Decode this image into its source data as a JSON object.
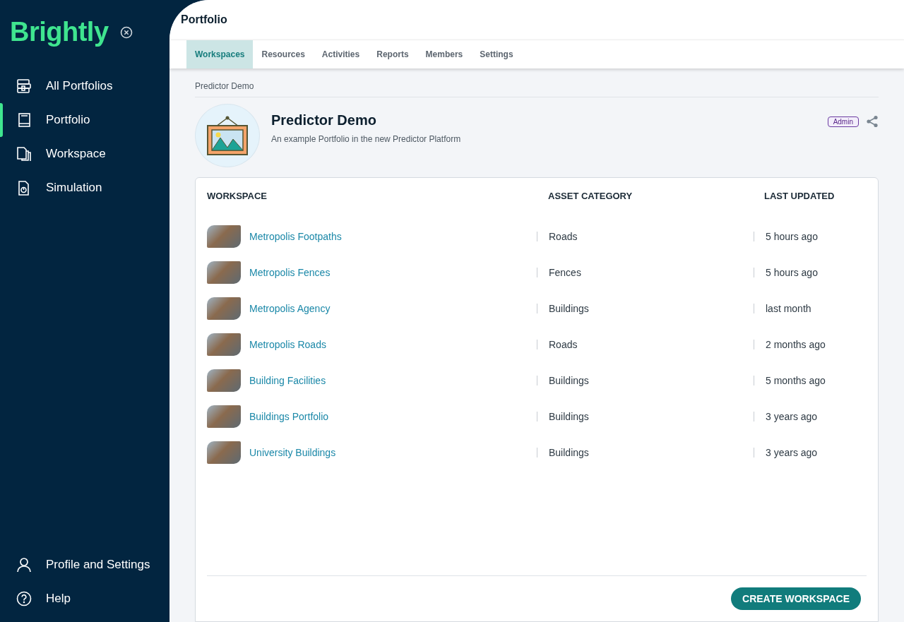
{
  "sidebar": {
    "logo": "Brightly",
    "items": [
      {
        "label": "All Portfolios",
        "selected": false
      },
      {
        "label": "Portfolio",
        "selected": true
      },
      {
        "label": "Workspace",
        "selected": false
      },
      {
        "label": "Simulation",
        "selected": false
      }
    ],
    "bottom_items": [
      {
        "label": "Profile and Settings"
      },
      {
        "label": "Help"
      }
    ]
  },
  "header": {
    "title": "Portfolio"
  },
  "tabs": [
    {
      "label": "Workspaces",
      "selected": true
    },
    {
      "label": "Resources",
      "selected": false
    },
    {
      "label": "Activities",
      "selected": false
    },
    {
      "label": "Reports",
      "selected": false
    },
    {
      "label": "Members",
      "selected": false
    },
    {
      "label": "Settings",
      "selected": false
    }
  ],
  "breadcrumb": "Predictor Demo",
  "portfolio": {
    "name": "Predictor Demo",
    "description": "An example Portfolio in the new Predictor Platform",
    "role": "Admin"
  },
  "table": {
    "columns": [
      "WORKSPACE",
      "ASSET CATEGORY",
      "LAST UPDATED"
    ],
    "rows": [
      {
        "name": "Metropolis Footpaths",
        "category": "Roads",
        "updated": "5 hours ago"
      },
      {
        "name": "Metropolis Fences",
        "category": "Fences",
        "updated": "5 hours ago"
      },
      {
        "name": "Metropolis Agency",
        "category": "Buildings",
        "updated": "last month"
      },
      {
        "name": "Metropolis Roads",
        "category": "Roads",
        "updated": "2 months ago"
      },
      {
        "name": "Building Facilities",
        "category": "Buildings",
        "updated": "5 months ago"
      },
      {
        "name": "Buildings Portfolio",
        "category": "Buildings",
        "updated": "3 years ago"
      },
      {
        "name": "University Buildings",
        "category": "Buildings",
        "updated": "3 years ago"
      }
    ]
  },
  "create_button": "CREATE WORKSPACE"
}
